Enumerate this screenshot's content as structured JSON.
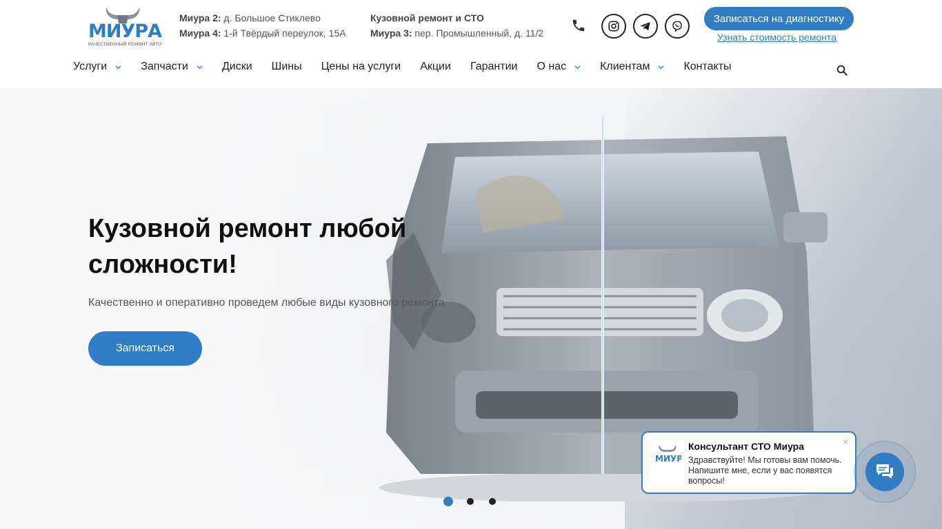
{
  "brand": {
    "name": "МИУРА",
    "tagline": "КАЧЕСТВЕННЫЙ РЕМОНТ АВТО",
    "accent_color": "#2f7dc4"
  },
  "addresses": {
    "col1": [
      {
        "label": "Миура 2:",
        "text": " д. Большое Стиклево"
      },
      {
        "label": "Миура 4:",
        "text": " 1-й Твёрдый переулок, 15А"
      }
    ],
    "col2": [
      {
        "label": "Кузовной ремонт и СТО",
        "text": ""
      },
      {
        "label": "Миура 3:",
        "text": " пер. Промышленный, д. 11/2"
      }
    ]
  },
  "header": {
    "phone_icon": "phone-icon",
    "socials": [
      "instagram-icon",
      "telegram-icon",
      "viber-icon"
    ],
    "cta_label": "Записаться на диагностику",
    "cost_link": "Узнать стоимость ремонта",
    "search_icon": "search-icon"
  },
  "nav": {
    "items": [
      {
        "label": "Услуги",
        "dropdown": true
      },
      {
        "label": "Запчасти",
        "dropdown": true
      },
      {
        "label": "Диски",
        "dropdown": false
      },
      {
        "label": "Шины",
        "dropdown": false
      },
      {
        "label": "Цены на услуги",
        "dropdown": false
      },
      {
        "label": "Акции",
        "dropdown": false
      },
      {
        "label": "Гарантии",
        "dropdown": false
      },
      {
        "label": "О нас",
        "dropdown": true
      },
      {
        "label": "Клиентам",
        "dropdown": true
      },
      {
        "label": "Контакты",
        "dropdown": false
      }
    ]
  },
  "hero": {
    "title": "Кузовной ремонт любой сложности!",
    "subtitle": "Качественно и оперативно проведем любые виды кузовного ремонта",
    "button": "Записаться",
    "slides": 3,
    "active_slide": 1
  },
  "chat": {
    "title": "Консультант СТО Миура",
    "message": "Здравствуйте! Мы готовы вам помочь. Напишите мне, если у вас появятся вопросы!",
    "close": "×"
  }
}
